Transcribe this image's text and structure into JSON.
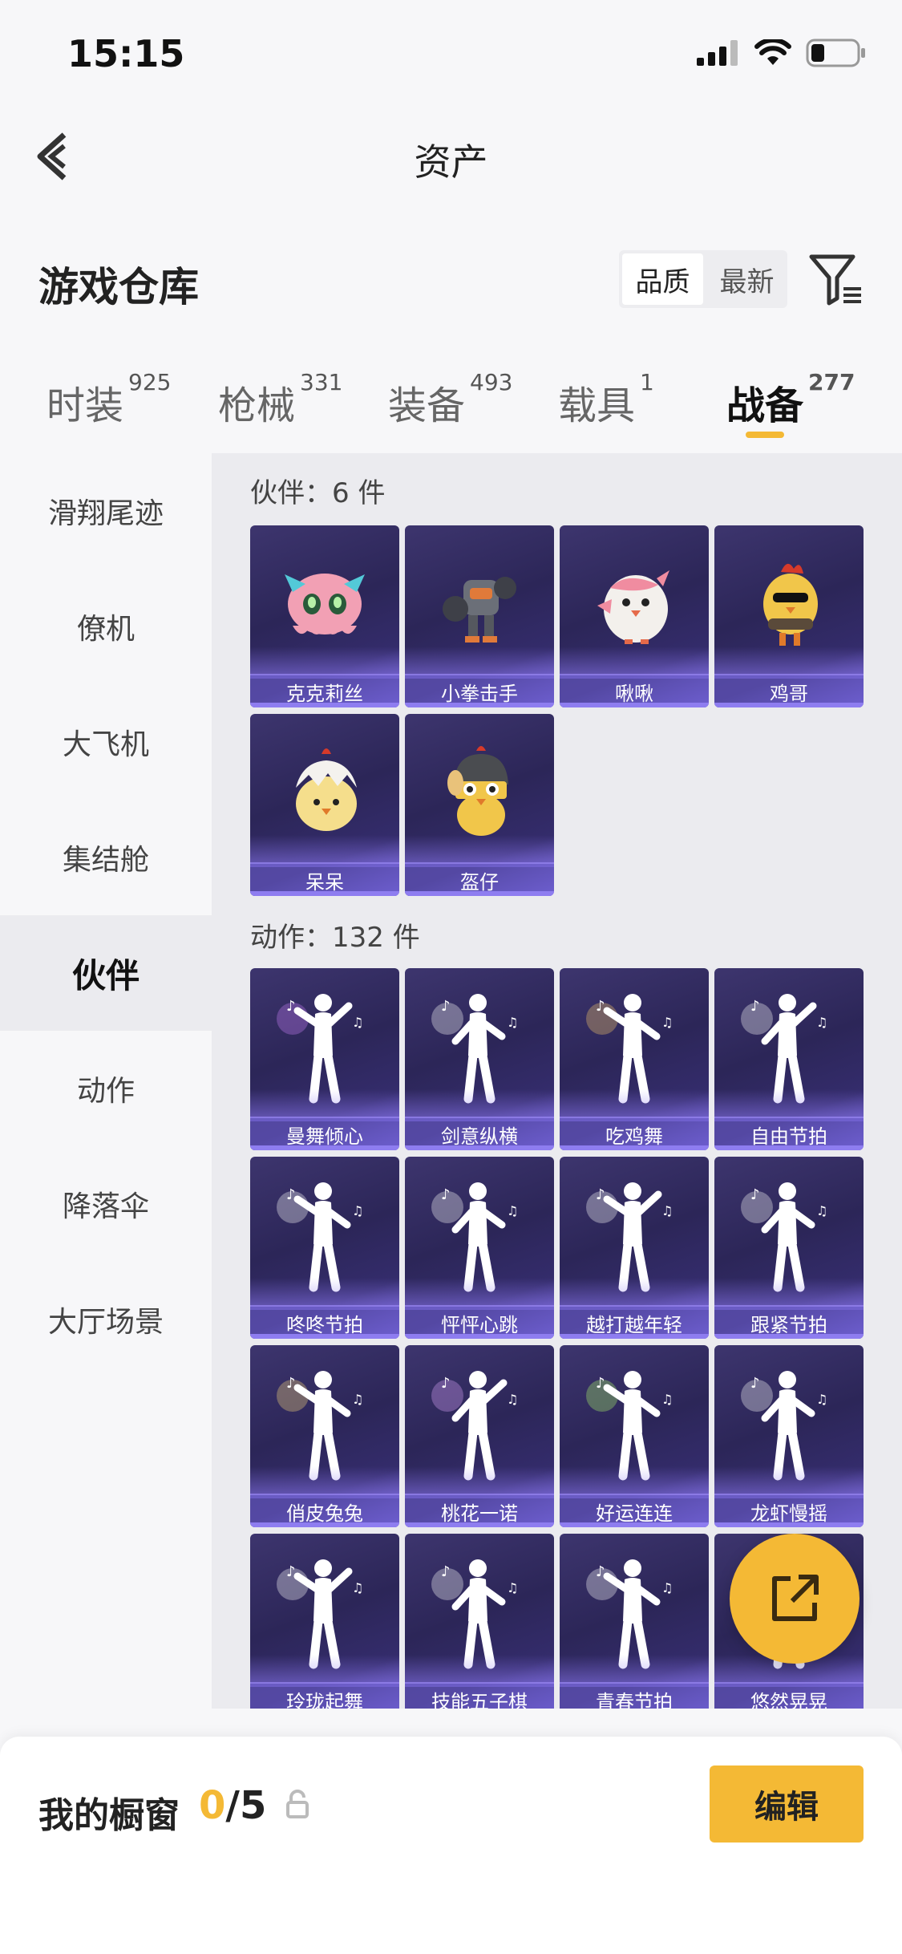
{
  "status": {
    "time": "15:15"
  },
  "nav": {
    "title": "资产"
  },
  "warehouse": {
    "title": "游戏仓库",
    "sort_options": [
      "品质",
      "最新"
    ]
  },
  "tabs": [
    {
      "label": "时装",
      "count": "925"
    },
    {
      "label": "枪械",
      "count": "331"
    },
    {
      "label": "装备",
      "count": "493"
    },
    {
      "label": "载具",
      "count": "1"
    },
    {
      "label": "战备",
      "count": "277"
    }
  ],
  "sidebar": {
    "items": [
      "滑翔尾迹",
      "僚机",
      "大飞机",
      "集结舱",
      "伙伴",
      "动作",
      "降落伞",
      "大厅场景"
    ],
    "active_index": 4
  },
  "sections": {
    "companions": {
      "title": "伙伴：6 件",
      "items": [
        {
          "label": "克克莉丝",
          "icon": "pink-octopus-icon"
        },
        {
          "label": "小拳击手",
          "icon": "robot-boxer-icon"
        },
        {
          "label": "啾啾",
          "icon": "pink-chick-icon"
        },
        {
          "label": "鸡哥",
          "icon": "rooster-sunglasses-icon"
        },
        {
          "label": "呆呆",
          "icon": "egg-chick-icon"
        },
        {
          "label": "盔仔",
          "icon": "helmet-chick-icon"
        }
      ]
    },
    "emotes": {
      "title": "动作：132 件",
      "items": [
        {
          "label": "曼舞倾心"
        },
        {
          "label": "剑意纵横"
        },
        {
          "label": "吃鸡舞"
        },
        {
          "label": "自由节拍"
        },
        {
          "label": "咚咚节拍"
        },
        {
          "label": "怦怦心跳"
        },
        {
          "label": "越打越年轻"
        },
        {
          "label": "跟紧节拍"
        },
        {
          "label": "俏皮兔兔"
        },
        {
          "label": "桃花一诺"
        },
        {
          "label": "好运连连"
        },
        {
          "label": "龙虾慢摇"
        },
        {
          "label": "玲珑起舞"
        },
        {
          "label": "技能五子棋"
        },
        {
          "label": "青春节拍"
        },
        {
          "label": "悠然晃晃"
        }
      ]
    }
  },
  "showcase": {
    "label": "我的橱窗",
    "current": "0",
    "total": "/5",
    "edit_label": "编辑"
  },
  "colors": {
    "accent": "#f4b935",
    "card_dark": "#2c2658",
    "card_light": "#6c5ccd"
  }
}
